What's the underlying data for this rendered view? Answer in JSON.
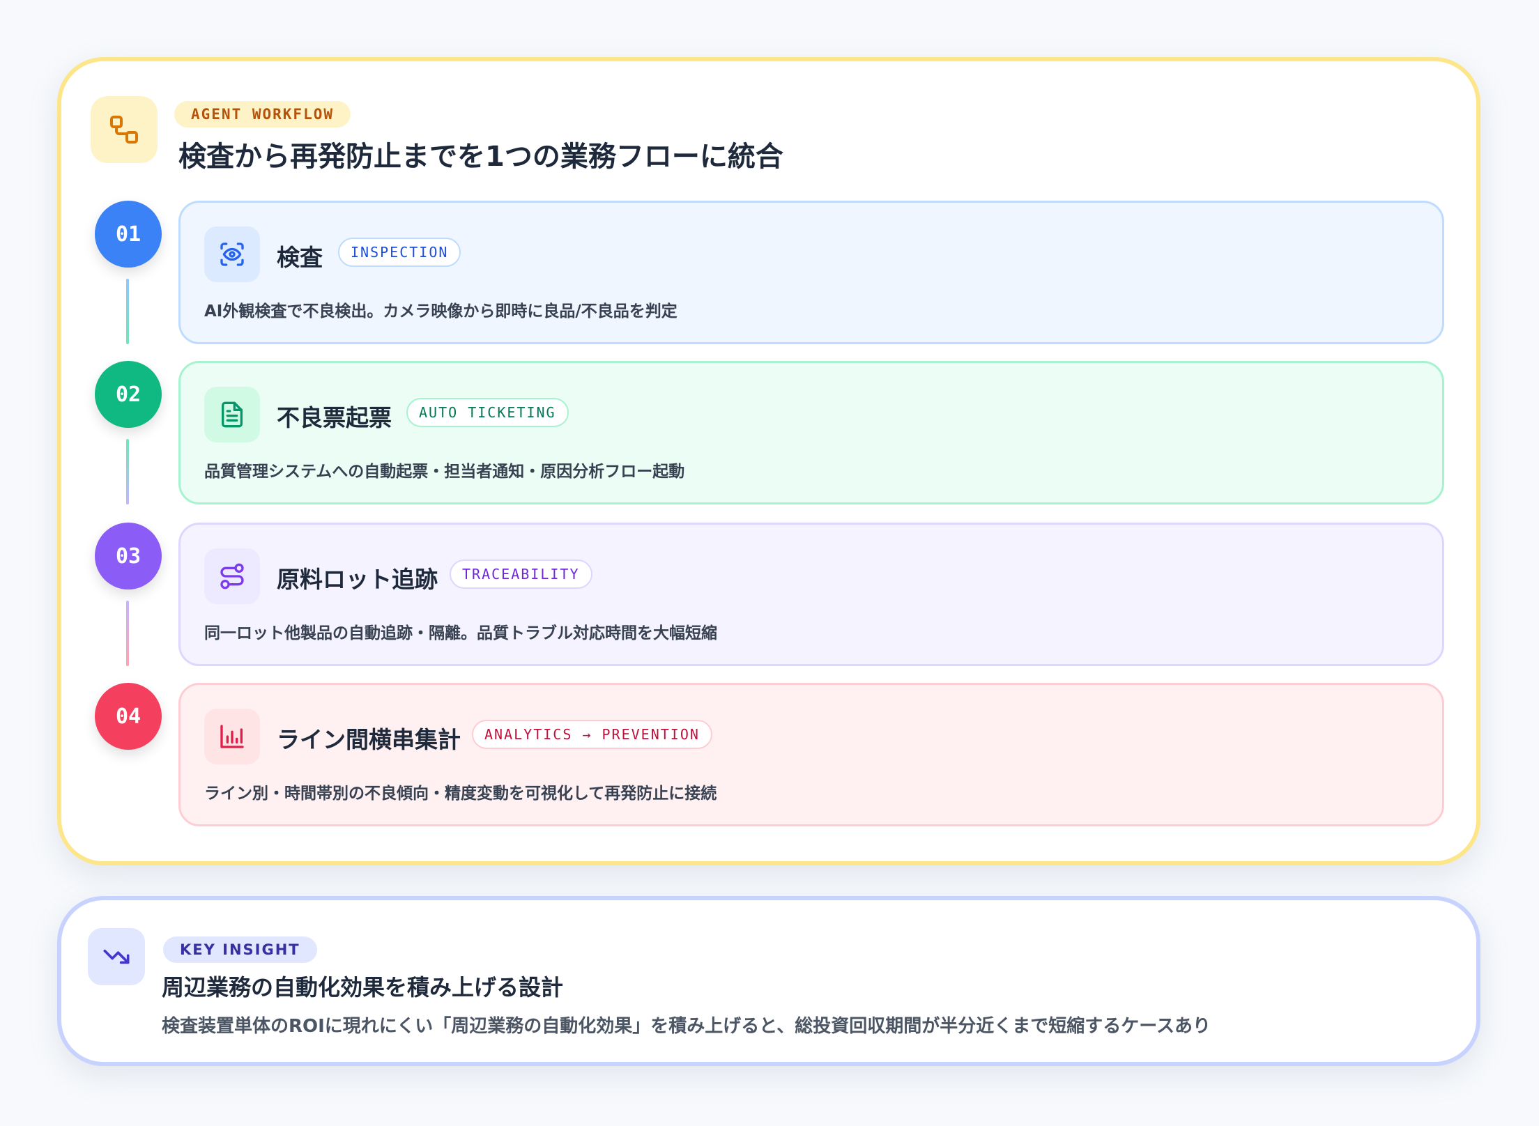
{
  "workflow": {
    "eyebrow": "AGENT WORKFLOW",
    "title": "検査から再発防止までを1つの業務フローに統合",
    "icon": "workflow-nodes-icon",
    "steps": [
      {
        "number": "01",
        "title": "検査",
        "tag": "INSPECTION",
        "description": "AI外観検査で不良検出。カメラ映像から即時に良品/不良品を判定",
        "icon": "eye-scan-icon",
        "accent": "#3b82f6",
        "background": "#eff6ff",
        "border": "#bfdbfe"
      },
      {
        "number": "02",
        "title": "不良票起票",
        "tag": "AUTO TICKETING",
        "description": "品質管理システムへの自動起票・担当者通知・原因分析フロー起動",
        "icon": "document-icon",
        "accent": "#10b981",
        "background": "#ecfdf5",
        "border": "#a7f3d0"
      },
      {
        "number": "03",
        "title": "原料ロット追跡",
        "tag": "TRACEABILITY",
        "description": "同一ロット他製品の自動追跡・隔離。品質トラブル対応時間を大幅短縮",
        "icon": "route-icon",
        "accent": "#8b5cf6",
        "background": "#f5f3ff",
        "border": "#ddd6fe"
      },
      {
        "number": "04",
        "title": "ライン間横串集計",
        "tag": "ANALYTICS → PREVENTION",
        "description": "ライン別・時間帯別の不良傾向・精度変動を可視化して再発防止に接続",
        "icon": "bar-chart-icon",
        "accent": "#f43f5e",
        "background": "#fff1f2",
        "border": "#fecdd3"
      }
    ]
  },
  "insight": {
    "eyebrow": "KEY INSIGHT",
    "title": "周辺業務の自動化効果を積み上げる設計",
    "description": "検査装置単体のROIに現れにくい「周辺業務の自動化効果」を積み上げると、総投資回収期間が半分近くまで短縮するケースあり",
    "icon": "trending-down-icon"
  }
}
